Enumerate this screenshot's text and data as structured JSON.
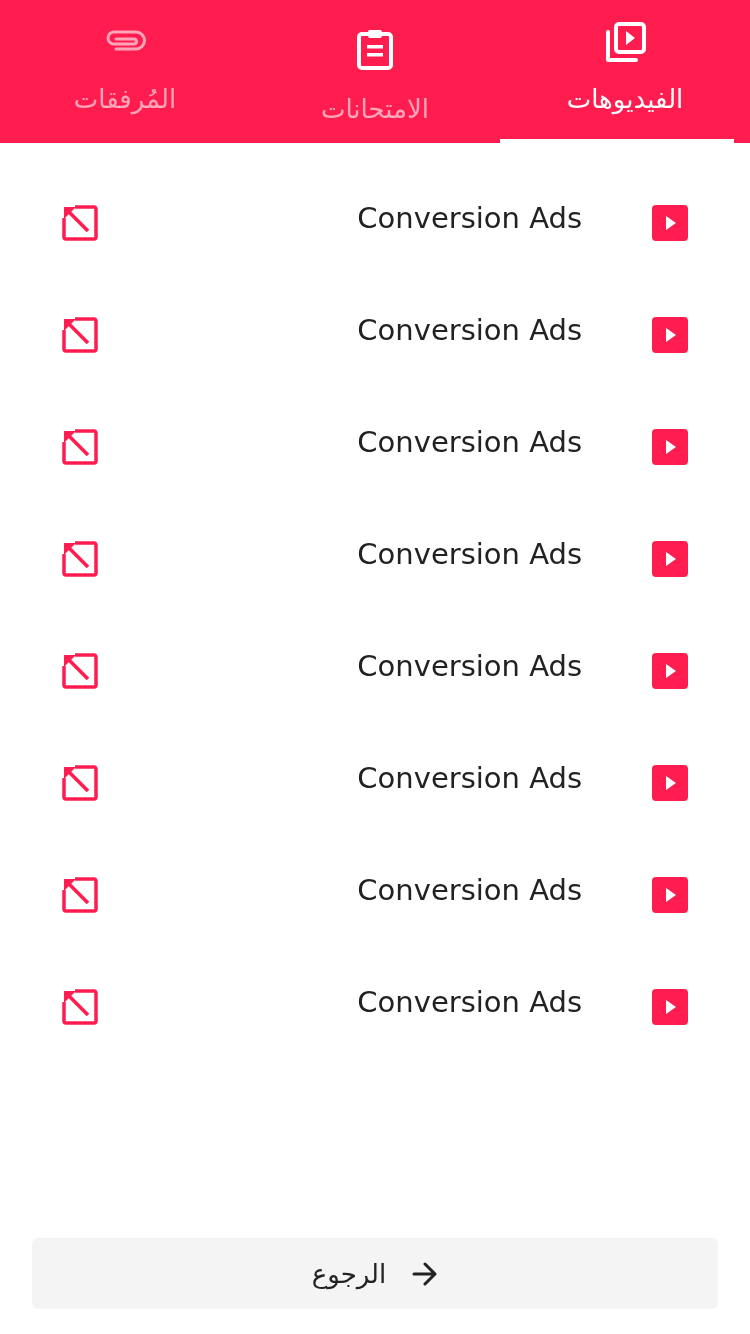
{
  "tabs": [
    {
      "kind": "videos",
      "label": "الفيديوهات",
      "selected": true,
      "icon_dimmed": false
    },
    {
      "kind": "exams",
      "label": "الامتحانات",
      "selected": false,
      "icon_dimmed": false
    },
    {
      "kind": "attachments",
      "label": "المُرفقات",
      "selected": false,
      "icon_dimmed": true
    }
  ],
  "videos": [
    {
      "title": "Conversion Ads"
    },
    {
      "title": "Conversion Ads"
    },
    {
      "title": "Conversion Ads"
    },
    {
      "title": "Conversion Ads"
    },
    {
      "title": "Conversion Ads"
    },
    {
      "title": "Conversion Ads"
    },
    {
      "title": "Conversion Ads"
    },
    {
      "title": "Conversion Ads"
    }
  ],
  "back_button": {
    "label": "الرجوع"
  }
}
